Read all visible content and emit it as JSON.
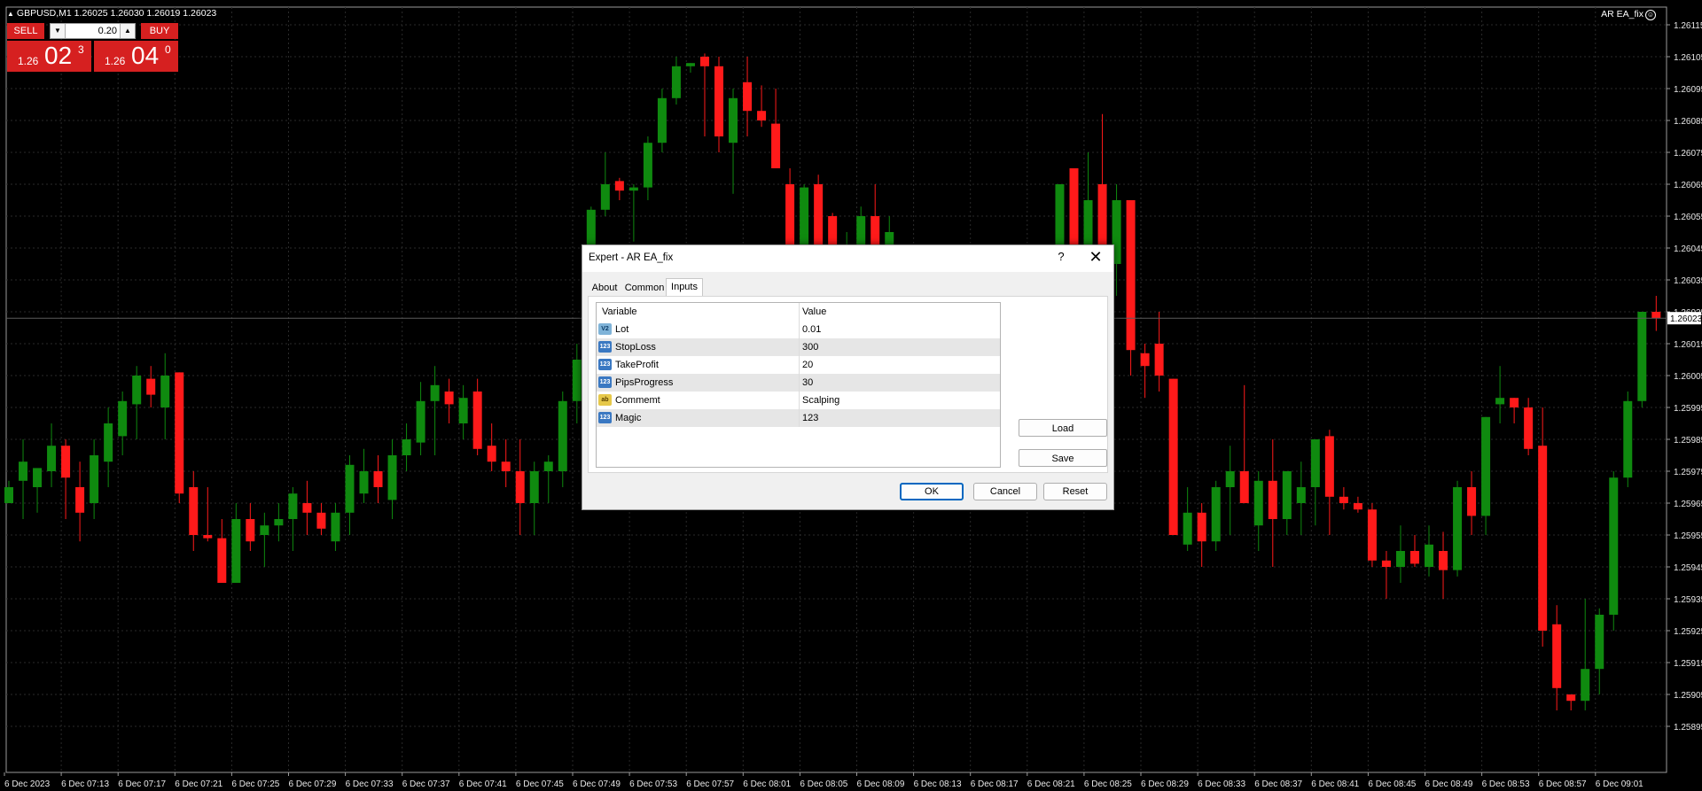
{
  "chart": {
    "symbol_header": "GBPUSD,M1  1.26025 1.26030 1.26019 1.26023",
    "ea_name": "AR EA_fix",
    "current_price_label": "1.26023",
    "price_axis_labels": [
      "1.26115",
      "1.26105",
      "1.26095",
      "1.26085",
      "1.26075",
      "1.26065",
      "1.26055",
      "1.26045",
      "1.26035",
      "1.26025",
      "1.26015",
      "1.26005",
      "1.25995",
      "1.25985",
      "1.25975",
      "1.25965",
      "1.25955",
      "1.25945",
      "1.25935",
      "1.25925",
      "1.25915",
      "1.25905",
      "1.25895"
    ],
    "time_axis_labels": [
      "6 Dec 2023",
      "6 Dec 07:13",
      "6 Dec 07:17",
      "6 Dec 07:21",
      "6 Dec 07:25",
      "6 Dec 07:29",
      "6 Dec 07:33",
      "6 Dec 07:37",
      "6 Dec 07:41",
      "6 Dec 07:45",
      "6 Dec 07:49",
      "6 Dec 07:53",
      "6 Dec 07:57",
      "6 Dec 08:01",
      "6 Dec 08:05",
      "6 Dec 08:09",
      "6 Dec 08:13",
      "6 Dec 08:17",
      "6 Dec 08:21",
      "6 Dec 08:25",
      "6 Dec 08:29",
      "6 Dec 08:33",
      "6 Dec 08:37",
      "6 Dec 08:41",
      "6 Dec 08:45",
      "6 Dec 08:49",
      "6 Dec 08:53",
      "6 Dec 08:57",
      "6 Dec 09:01"
    ],
    "bull_color": "#0f8a0f",
    "bear_color": "#ff1a1a",
    "grid_color": "#2a2a2a",
    "candles": [
      [
        1.25965,
        1.25972,
        1.25965,
        1.2597
      ],
      [
        1.25972,
        1.25985,
        1.2596,
        1.25978
      ],
      [
        1.2597,
        1.25975,
        1.25962,
        1.25976
      ],
      [
        1.25975,
        1.2599,
        1.2597,
        1.25983
      ],
      [
        1.25983,
        1.25985,
        1.2596,
        1.25973
      ],
      [
        1.2597,
        1.25978,
        1.25953,
        1.25962
      ],
      [
        1.25965,
        1.25985,
        1.2596,
        1.2598
      ],
      [
        1.25978,
        1.25995,
        1.2597,
        1.2599
      ],
      [
        1.25986,
        1.26,
        1.2598,
        1.25997
      ],
      [
        1.25996,
        1.26008,
        1.25985,
        1.26005
      ],
      [
        1.26004,
        1.26008,
        1.25995,
        1.25999
      ],
      [
        1.25995,
        1.26012,
        1.25985,
        1.26005
      ],
      [
        1.26006,
        1.26006,
        1.25965,
        1.25968
      ],
      [
        1.2597,
        1.25975,
        1.2595,
        1.25955
      ],
      [
        1.25955,
        1.2597,
        1.25953,
        1.25954
      ],
      [
        1.25954,
        1.2596,
        1.2594,
        1.2594
      ],
      [
        1.2594,
        1.25965,
        1.2594,
        1.2596
      ],
      [
        1.2596,
        1.25965,
        1.2595,
        1.25953
      ],
      [
        1.25955,
        1.25962,
        1.25945,
        1.25958
      ],
      [
        1.25958,
        1.25965,
        1.25953,
        1.2596
      ],
      [
        1.2596,
        1.2597,
        1.2595,
        1.25968
      ],
      [
        1.25965,
        1.25972,
        1.25955,
        1.25962
      ],
      [
        1.25962,
        1.25965,
        1.25955,
        1.25957
      ],
      [
        1.25953,
        1.25965,
        1.2595,
        1.25962
      ],
      [
        1.25962,
        1.2598,
        1.25955,
        1.25977
      ],
      [
        1.25968,
        1.25982,
        1.25965,
        1.25975
      ],
      [
        1.25975,
        1.2598,
        1.25965,
        1.2597
      ],
      [
        1.25966,
        1.25985,
        1.2596,
        1.2598
      ],
      [
        1.2598,
        1.2599,
        1.25975,
        1.25985
      ],
      [
        1.25984,
        1.26003,
        1.2598,
        1.25997
      ],
      [
        1.25997,
        1.26008,
        1.2598,
        1.26002
      ],
      [
        1.26,
        1.26004,
        1.2599,
        1.25996
      ],
      [
        1.2599,
        1.26002,
        1.25985,
        1.25998
      ],
      [
        1.26,
        1.26004,
        1.2598,
        1.25982
      ],
      [
        1.25983,
        1.2599,
        1.25975,
        1.25978
      ],
      [
        1.25978,
        1.25985,
        1.2597,
        1.25975
      ],
      [
        1.25975,
        1.25985,
        1.25955,
        1.25965
      ],
      [
        1.25965,
        1.25978,
        1.25955,
        1.25975
      ],
      [
        1.25975,
        1.2598,
        1.25965,
        1.25978
      ],
      [
        1.25975,
        1.26,
        1.2597,
        1.25997
      ],
      [
        1.25997,
        1.26015,
        1.2599,
        1.2601
      ],
      [
        1.2601,
        1.26058,
        1.26005,
        1.26057
      ],
      [
        1.26057,
        1.26075,
        1.26055,
        1.26065
      ],
      [
        1.26066,
        1.26067,
        1.2606,
        1.26063
      ],
      [
        1.26063,
        1.26065,
        1.26047,
        1.26064
      ],
      [
        1.26064,
        1.2608,
        1.2606,
        1.26078
      ],
      [
        1.26078,
        1.26095,
        1.26075,
        1.26092
      ],
      [
        1.26092,
        1.26105,
        1.2609,
        1.26102
      ],
      [
        1.26102,
        1.26103,
        1.261,
        1.26103
      ],
      [
        1.26105,
        1.26106,
        1.2608,
        1.26102
      ],
      [
        1.26102,
        1.26105,
        1.26075,
        1.2608
      ],
      [
        1.26078,
        1.26095,
        1.26062,
        1.26092
      ],
      [
        1.26097,
        1.26105,
        1.2608,
        1.26088
      ],
      [
        1.26088,
        1.26096,
        1.26083,
        1.26085
      ],
      [
        1.26084,
        1.26095,
        1.2607,
        1.2607
      ],
      [
        1.26065,
        1.2607,
        1.26032,
        1.26035
      ],
      [
        1.26035,
        1.26065,
        1.2603,
        1.26064
      ],
      [
        1.26065,
        1.26068,
        1.26032,
        1.26035
      ]
    ],
    "candles_right": [
      [
        1.26055,
        1.26056,
        1.2604,
        1.26043
      ],
      [
        1.26043,
        1.2605,
        1.26035,
        1.26043
      ],
      [
        1.26043,
        1.26058,
        1.26035,
        1.26055
      ],
      [
        1.26055,
        1.26065,
        1.2604,
        1.26045
      ],
      [
        1.26045,
        1.26055,
        1.2604,
        1.2605
      ]
    ],
    "candles_right2": [
      [
        1.2604,
        1.26065,
        1.26035,
        1.26065
      ],
      [
        1.2607,
        1.2607,
        1.26035,
        1.2604
      ],
      [
        1.2604,
        1.26075,
        1.2603,
        1.2606
      ],
      [
        1.26065,
        1.26087,
        1.26035,
        1.2604
      ],
      [
        1.2604,
        1.26065,
        1.2603,
        1.2606
      ],
      [
        1.2606,
        1.2606,
        1.26005,
        1.26013
      ],
      [
        1.26012,
        1.26015,
        1.25998,
        1.26008
      ],
      [
        1.26015,
        1.26025,
        1.26,
        1.26005
      ],
      [
        1.26004,
        1.26004,
        1.25955,
        1.25955
      ],
      [
        1.25952,
        1.2597,
        1.2595,
        1.25962
      ],
      [
        1.25962,
        1.25965,
        1.25945,
        1.25953
      ],
      [
        1.25953,
        1.25972,
        1.2595,
        1.2597
      ],
      [
        1.2597,
        1.25983,
        1.25955,
        1.25975
      ],
      [
        1.25975,
        1.26002,
        1.2597,
        1.25965
      ],
      [
        1.25958,
        1.25975,
        1.2595,
        1.25972
      ],
      [
        1.25972,
        1.25985,
        1.25945,
        1.2596
      ],
      [
        1.2596,
        1.25975,
        1.25955,
        1.25975
      ],
      [
        1.25965,
        1.25978,
        1.25955,
        1.2597
      ],
      [
        1.2597,
        1.25985,
        1.25958,
        1.25985
      ],
      [
        1.25986,
        1.25988,
        1.25955,
        1.25967
      ],
      [
        1.25967,
        1.2597,
        1.25963,
        1.25965
      ],
      [
        1.25965,
        1.25967,
        1.25962,
        1.25963
      ],
      [
        1.25963,
        1.25965,
        1.25945,
        1.25947
      ],
      [
        1.25947,
        1.2595,
        1.25935,
        1.25945
      ],
      [
        1.25945,
        1.25958,
        1.2594,
        1.2595
      ],
      [
        1.2595,
        1.25955,
        1.25945,
        1.25946
      ],
      [
        1.25945,
        1.25958,
        1.25942,
        1.25952
      ],
      [
        1.2595,
        1.25956,
        1.25935,
        1.25944
      ],
      [
        1.25944,
        1.25972,
        1.25942,
        1.2597
      ],
      [
        1.2597,
        1.25975,
        1.25955,
        1.25961
      ],
      [
        1.25961,
        1.25992,
        1.25955,
        1.25992
      ],
      [
        1.25996,
        1.26008,
        1.2599,
        1.25998
      ],
      [
        1.25998,
        1.25998,
        1.2599,
        1.25995
      ],
      [
        1.25995,
        1.25998,
        1.2598,
        1.25982
      ],
      [
        1.25983,
        1.25995,
        1.2592,
        1.25925
      ],
      [
        1.25927,
        1.25933,
        1.259,
        1.25907
      ],
      [
        1.25905,
        1.25905,
        1.259,
        1.25903
      ],
      [
        1.25903,
        1.25935,
        1.259,
        1.25913
      ],
      [
        1.25913,
        1.25932,
        1.25905,
        1.2593
      ],
      [
        1.2593,
        1.25975,
        1.25925,
        1.25973
      ],
      [
        1.25973,
        1.26,
        1.2597,
        1.25997
      ],
      [
        1.25997,
        1.26025,
        1.25995,
        1.26025
      ],
      [
        1.26025,
        1.2603,
        1.26019,
        1.26023
      ]
    ]
  },
  "trade_panel": {
    "sell_label": "SELL",
    "buy_label": "BUY",
    "lot_value": "0.20",
    "sell_prefix": "1.26",
    "sell_big": "02",
    "sell_sup": "3",
    "buy_prefix": "1.26",
    "buy_big": "04",
    "buy_sup": "0"
  },
  "dialog": {
    "title": "Expert - AR EA_fix",
    "help": "?",
    "close": "✕",
    "tabs": [
      "About",
      "Common",
      "Inputs"
    ],
    "active_tab": "Inputs",
    "col_variable": "Variable",
    "col_value": "Value",
    "params": [
      {
        "icon": "V2",
        "name": "Lot",
        "value": "0.01"
      },
      {
        "icon": "123",
        "name": "StopLoss",
        "value": "300"
      },
      {
        "icon": "123",
        "name": "TakeProfit",
        "value": "20"
      },
      {
        "icon": "123",
        "name": "PipsProgress",
        "value": "30"
      },
      {
        "icon": "ab",
        "name": "Commemt",
        "value": "Scalping"
      },
      {
        "icon": "123",
        "name": "Magic",
        "value": "123"
      }
    ],
    "load_label": "Load",
    "save_label": "Save",
    "ok_label": "OK",
    "cancel_label": "Cancel",
    "reset_label": "Reset"
  }
}
